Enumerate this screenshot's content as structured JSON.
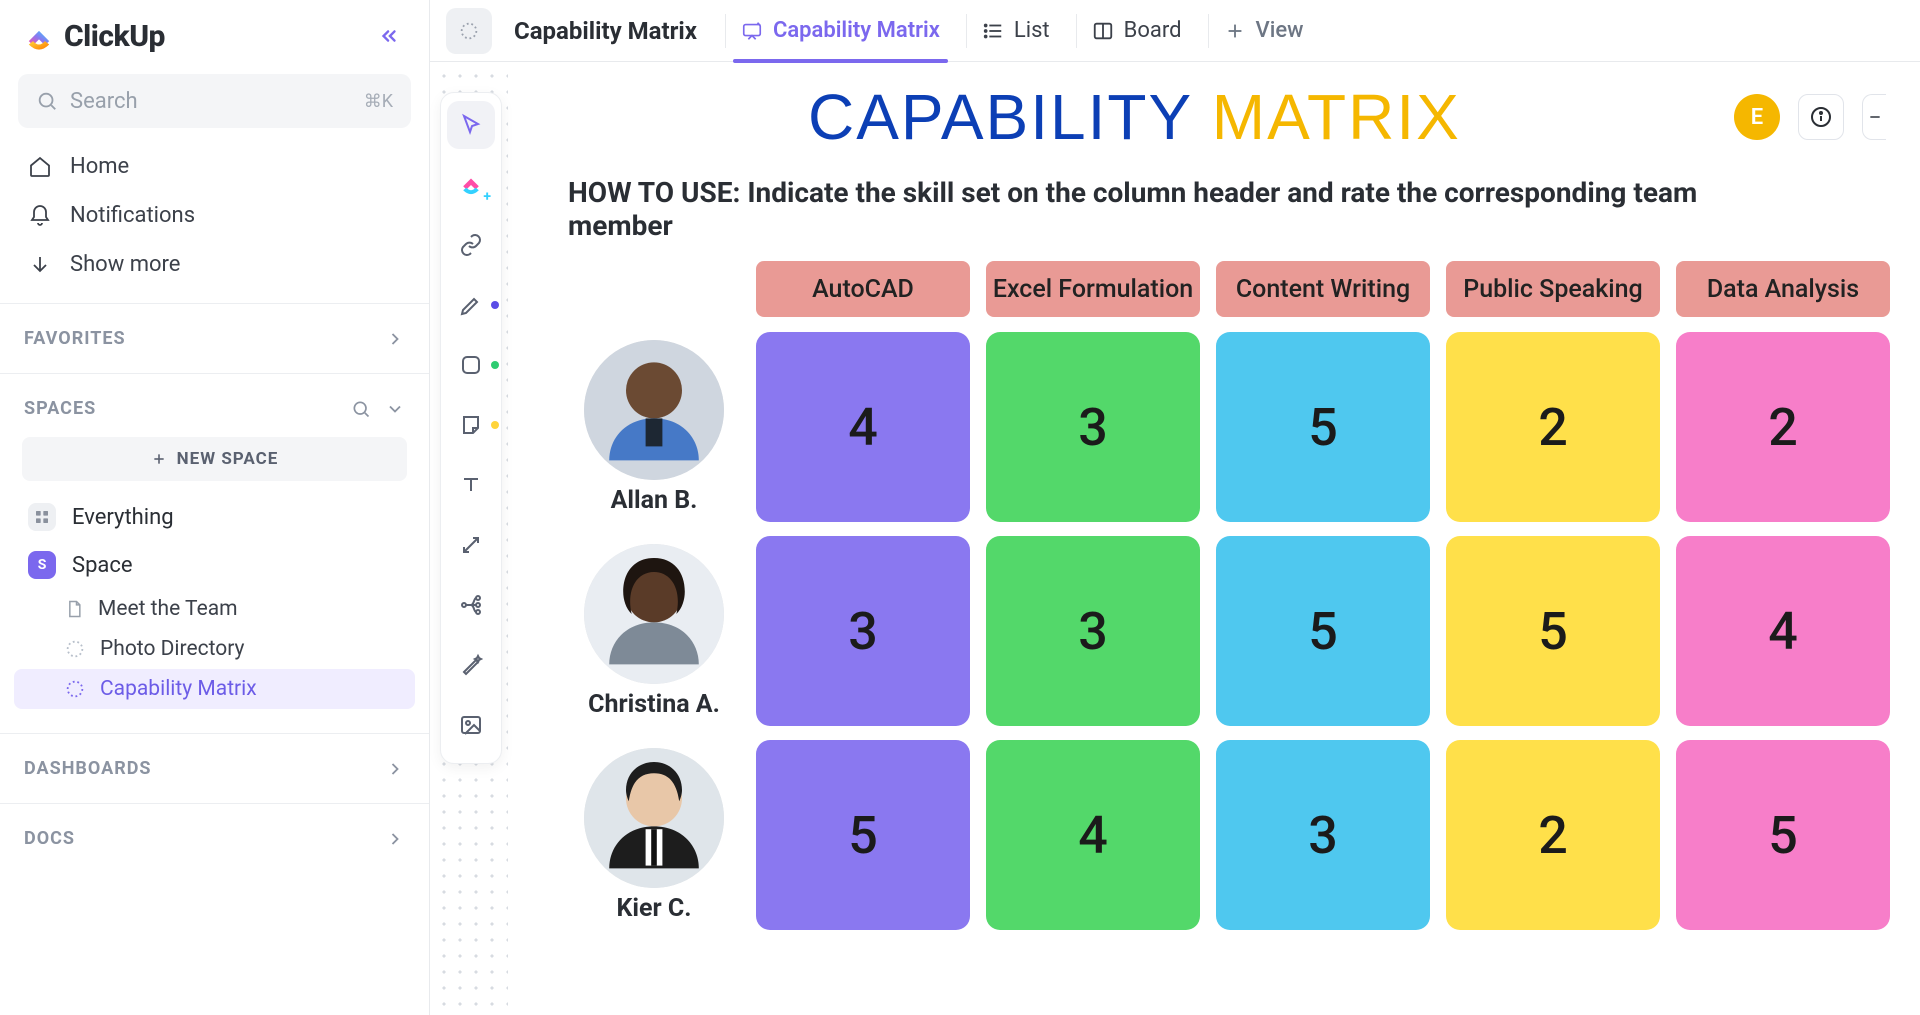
{
  "app": {
    "name": "ClickUp"
  },
  "search": {
    "placeholder": "Search",
    "shortcut": "⌘K"
  },
  "nav": {
    "home": "Home",
    "notifications": "Notifications",
    "show_more": "Show more"
  },
  "sections": {
    "favorites": "FAVORITES",
    "spaces": "SPACES",
    "dashboards": "DASHBOARDS",
    "docs": "DOCS"
  },
  "sidebar": {
    "new_space": "NEW SPACE",
    "everything": "Everything",
    "space": "Space",
    "space_initial": "S",
    "items": [
      {
        "label": "Meet the Team"
      },
      {
        "label": "Photo Directory"
      },
      {
        "label": "Capability Matrix"
      }
    ]
  },
  "breadcrumb": {
    "title": "Capability Matrix"
  },
  "tabs": {
    "whiteboard": "Capability Matrix",
    "list": "List",
    "board": "Board",
    "addview": "View"
  },
  "header": {
    "title_a": "CAPABILITY",
    "title_b": "MATRIX",
    "avatar_initial": "E"
  },
  "howto": "HOW TO USE: Indicate the skill set on the column header and rate the corresponding team member",
  "skills": [
    "AutoCAD",
    "Excel Formulation",
    "Content Writing",
    "Public Speaking",
    "Data Analysis"
  ],
  "colors": {
    "skill_header_bg": "#e99a95",
    "columns": [
      "#8a78f0",
      "#53d86a",
      "#4fc8ef",
      "#ffe04a",
      "#f77ec9"
    ]
  },
  "people": [
    {
      "name": "Allan B.",
      "ratings": [
        4,
        3,
        5,
        2,
        2
      ]
    },
    {
      "name": "Christina A.",
      "ratings": [
        3,
        3,
        5,
        5,
        4
      ]
    },
    {
      "name": "Kier C.",
      "ratings": [
        5,
        4,
        3,
        2,
        5
      ]
    }
  ],
  "chart_data": {
    "type": "heatmap",
    "title": "Capability Matrix",
    "rows": [
      "Allan B.",
      "Christina A.",
      "Kier C."
    ],
    "columns": [
      "AutoCAD",
      "Excel Formulation",
      "Content Writing",
      "Public Speaking",
      "Data Analysis"
    ],
    "values": [
      [
        4,
        3,
        5,
        2,
        2
      ],
      [
        3,
        3,
        5,
        5,
        4
      ],
      [
        5,
        4,
        3,
        2,
        5
      ]
    ],
    "value_range": [
      1,
      5
    ]
  }
}
